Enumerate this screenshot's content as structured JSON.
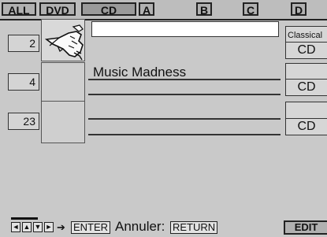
{
  "tabs": [
    {
      "label": "ALL"
    },
    {
      "label": "DVD"
    },
    {
      "label": "CD"
    },
    {
      "label": "A"
    },
    {
      "label": "B"
    },
    {
      "label": "C"
    },
    {
      "label": "D"
    }
  ],
  "entries": [
    {
      "number": "2",
      "title": "",
      "genre": "Classical",
      "format": "CD"
    },
    {
      "number": "4",
      "title": "Music Madness",
      "genre": "",
      "format": "CD"
    },
    {
      "number": "23",
      "title": "",
      "genre": "",
      "format": "CD"
    }
  ],
  "footer": {
    "arrow_left": "◄",
    "arrow_up": "▲",
    "arrow_down": "▼",
    "arrow_right": "►",
    "arrow_then": "➔",
    "enter_key": "ENTER",
    "cancel_label": "Annuler:",
    "return_key": "RETURN",
    "edit_label": "EDIT"
  },
  "colors": {
    "background": "#c9c9c9",
    "selected_title": "#ffffff"
  }
}
